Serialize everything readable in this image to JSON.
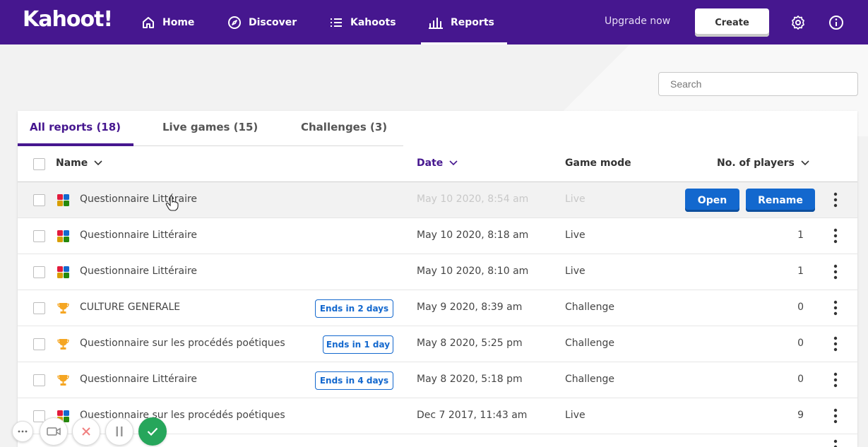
{
  "nav": {
    "logo": "Kahoot!",
    "items": [
      {
        "label": "Home",
        "icon": "home-icon"
      },
      {
        "label": "Discover",
        "icon": "compass-icon"
      },
      {
        "label": "Kahoots",
        "icon": "list-icon"
      },
      {
        "label": "Reports",
        "icon": "reports-chart-icon",
        "active": true
      }
    ],
    "upgrade": "Upgrade now",
    "create": "Create"
  },
  "search": {
    "placeholder": "Search"
  },
  "tabs": [
    {
      "label": "All reports (18)",
      "active": true
    },
    {
      "label": "Live games (15)"
    },
    {
      "label": "Challenges (3)"
    }
  ],
  "table": {
    "headers": {
      "name": "Name",
      "date": "Date",
      "mode": "Game mode",
      "players": "No. of players"
    },
    "rows": [
      {
        "icon": "live-game-icon",
        "name": "Questionnaire Littéraire",
        "date": "May 10 2020, 8:54 am",
        "mode": "Live",
        "players": "",
        "badge": ""
      },
      {
        "icon": "live-game-icon",
        "name": "Questionnaire Littéraire",
        "date": "May 10 2020, 8:18 am",
        "mode": "Live",
        "players": "1",
        "badge": ""
      },
      {
        "icon": "live-game-icon",
        "name": "Questionnaire Littéraire",
        "date": "May 10 2020, 8:10 am",
        "mode": "Live",
        "players": "1",
        "badge": ""
      },
      {
        "icon": "trophy-icon",
        "name": "CULTURE GENERALE",
        "date": "May 9 2020, 8:39 am",
        "mode": "Challenge",
        "players": "0",
        "badge": "Ends in 2 days"
      },
      {
        "icon": "trophy-icon",
        "name": "Questionnaire sur les procédés poétiques",
        "date": "May 8 2020, 5:25 pm",
        "mode": "Challenge",
        "players": "0",
        "badge": "Ends in 1 day"
      },
      {
        "icon": "trophy-icon",
        "name": "Questionnaire Littéraire",
        "date": "May 8 2020, 5:18 pm",
        "mode": "Challenge",
        "players": "0",
        "badge": "Ends in 4 days"
      },
      {
        "icon": "live-game-icon",
        "name": "Questionnaire sur les procédés poétiques",
        "date": "Dec 7 2017, 11:43 am",
        "mode": "Live",
        "players": "9",
        "badge": ""
      }
    ],
    "row_actions": {
      "open": "Open",
      "rename": "Rename"
    }
  },
  "colors": {
    "brand_purple": "#46178f",
    "action_blue": "#1368ce",
    "trophy_gold": "#f5a623",
    "recorder_green": "#26a65b"
  }
}
